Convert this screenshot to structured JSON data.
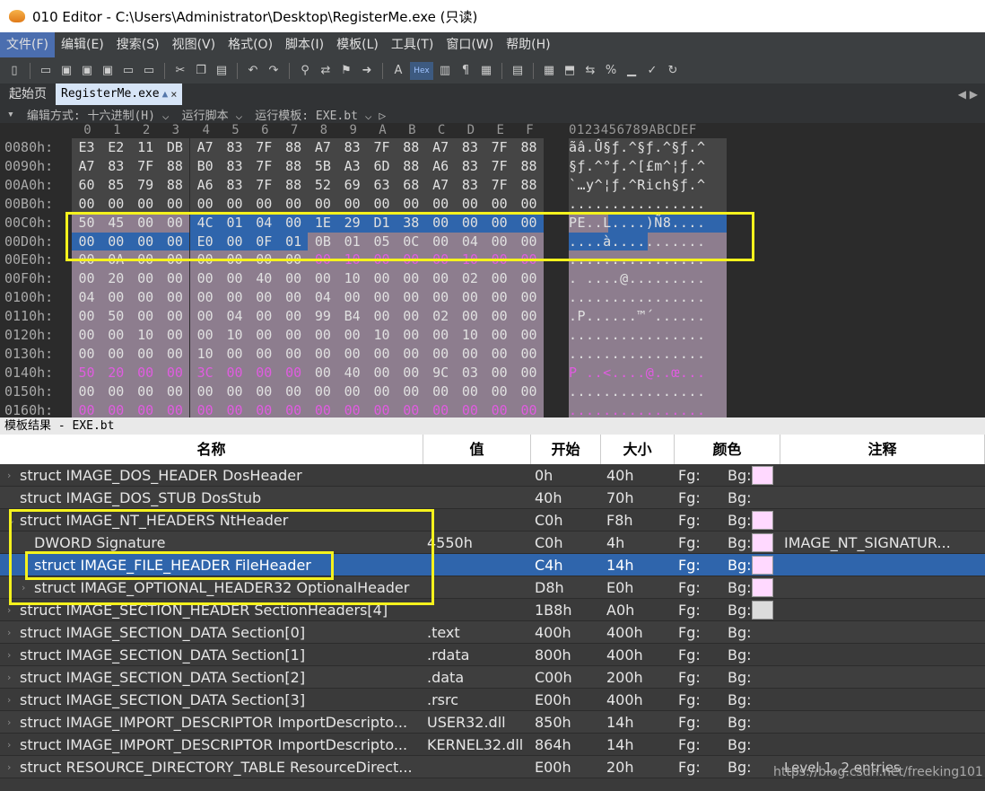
{
  "window": {
    "title": "010 Editor - C:\\Users\\Administrator\\Desktop\\RegisterMe.exe (只读)"
  },
  "menu": [
    "文件(F)",
    "编辑(E)",
    "搜索(S)",
    "视图(V)",
    "格式(O)",
    "脚本(I)",
    "模板(L)",
    "工具(T)",
    "窗口(W)",
    "帮助(H)"
  ],
  "toolbar": {
    "icons": [
      "new-file-icon",
      "open-folder-icon",
      "save-icon",
      "save-as-icon",
      "save-all-icon",
      "open-icon",
      "copy-files-icon",
      "cut-icon",
      "copy-icon",
      "paste-icon",
      "undo-icon",
      "redo-icon",
      "find-icon",
      "replace-icon",
      "find-files-icon",
      "goto-icon",
      "font-icon",
      "hex-icon",
      "columns-icon",
      "pilcrow-icon",
      "grid-icon",
      "binary-icon",
      "calculator-icon",
      "compare-icon",
      "swap-icon",
      "percent-icon",
      "histogram-icon",
      "check-icon",
      "convert-icon"
    ],
    "hex_label": "Hex"
  },
  "tabs": {
    "start": "起始页",
    "active": "RegisterMe.exe",
    "close": "×",
    "arrows": "◀ ▶"
  },
  "options": {
    "edit_mode": "编辑方式: 十六进制(H) ⌵",
    "run_script": "运行脚本 ⌵",
    "run_template": "运行模板: EXE.bt ⌵ ▷"
  },
  "hex": {
    "columns": [
      "0",
      "1",
      "2",
      "3",
      "4",
      "5",
      "6",
      "7",
      "8",
      "9",
      "A",
      "B",
      "C",
      "D",
      "E",
      "F"
    ],
    "ascii_header": "0123456789ABCDEF",
    "rows": [
      {
        "addr": "0080h:",
        "bytes": [
          "E3",
          "E2",
          "11",
          "DB",
          "A7",
          "83",
          "7F",
          "88",
          "A7",
          "83",
          "7F",
          "88",
          "A7",
          "83",
          "7F",
          "88"
        ],
        "ascii": "ãâ.Û§ƒ.^§ƒ.^§ƒ.^"
      },
      {
        "addr": "0090h:",
        "bytes": [
          "A7",
          "83",
          "7F",
          "88",
          "B0",
          "83",
          "7F",
          "88",
          "5B",
          "A3",
          "6D",
          "88",
          "A6",
          "83",
          "7F",
          "88"
        ],
        "ascii": "§ƒ.^°ƒ.^[£m^¦ƒ.^"
      },
      {
        "addr": "00A0h:",
        "bytes": [
          "60",
          "85",
          "79",
          "88",
          "A6",
          "83",
          "7F",
          "88",
          "52",
          "69",
          "63",
          "68",
          "A7",
          "83",
          "7F",
          "88"
        ],
        "ascii": "`…y^¦ƒ.^Rich§ƒ.^"
      },
      {
        "addr": "00B0h:",
        "bytes": [
          "00",
          "00",
          "00",
          "00",
          "00",
          "00",
          "00",
          "00",
          "00",
          "00",
          "00",
          "00",
          "00",
          "00",
          "00",
          "00"
        ],
        "ascii": "................"
      },
      {
        "addr": "00C0h:",
        "bytes": [
          "50",
          "45",
          "00",
          "00",
          "4C",
          "01",
          "04",
          "00",
          "1E",
          "29",
          "D1",
          "38",
          "00",
          "00",
          "00",
          "00"
        ],
        "ascii": "PE..L....)Ñ8...."
      },
      {
        "addr": "00D0h:",
        "bytes": [
          "00",
          "00",
          "00",
          "00",
          "E0",
          "00",
          "0F",
          "01",
          "0B",
          "01",
          "05",
          "0C",
          "00",
          "04",
          "00",
          "00"
        ],
        "ascii": "....à..........."
      },
      {
        "addr": "00E0h:",
        "bytes": [
          "00",
          "0A",
          "00",
          "00",
          "00",
          "00",
          "00",
          "00",
          "00",
          "10",
          "00",
          "00",
          "00",
          "10",
          "00",
          "00"
        ],
        "ascii": "................"
      },
      {
        "addr": "00F0h:",
        "bytes": [
          "00",
          "20",
          "00",
          "00",
          "00",
          "00",
          "40",
          "00",
          "00",
          "10",
          "00",
          "00",
          "00",
          "02",
          "00",
          "00"
        ],
        "ascii": ". ....@........."
      },
      {
        "addr": "0100h:",
        "bytes": [
          "04",
          "00",
          "00",
          "00",
          "00",
          "00",
          "00",
          "00",
          "04",
          "00",
          "00",
          "00",
          "00",
          "00",
          "00",
          "00"
        ],
        "ascii": "................"
      },
      {
        "addr": "0110h:",
        "bytes": [
          "00",
          "50",
          "00",
          "00",
          "00",
          "04",
          "00",
          "00",
          "99",
          "B4",
          "00",
          "00",
          "02",
          "00",
          "00",
          "00"
        ],
        "ascii": ".P......™´......"
      },
      {
        "addr": "0120h:",
        "bytes": [
          "00",
          "00",
          "10",
          "00",
          "00",
          "10",
          "00",
          "00",
          "00",
          "00",
          "10",
          "00",
          "00",
          "10",
          "00",
          "00"
        ],
        "ascii": "................"
      },
      {
        "addr": "0130h:",
        "bytes": [
          "00",
          "00",
          "00",
          "00",
          "10",
          "00",
          "00",
          "00",
          "00",
          "00",
          "00",
          "00",
          "00",
          "00",
          "00",
          "00"
        ],
        "ascii": "................"
      },
      {
        "addr": "0140h:",
        "bytes": [
          "50",
          "20",
          "00",
          "00",
          "3C",
          "00",
          "00",
          "00",
          "00",
          "40",
          "00",
          "00",
          "9C",
          "03",
          "00",
          "00"
        ],
        "ascii": "P ..<....@..œ..."
      },
      {
        "addr": "0150h:",
        "bytes": [
          "00",
          "00",
          "00",
          "00",
          "00",
          "00",
          "00",
          "00",
          "00",
          "00",
          "00",
          "00",
          "00",
          "00",
          "00",
          "00"
        ],
        "ascii": "................"
      },
      {
        "addr": "0160h:",
        "bytes": [
          "00",
          "00",
          "00",
          "00",
          "00",
          "00",
          "00",
          "00",
          "00",
          "00",
          "00",
          "00",
          "00",
          "00",
          "00",
          "00"
        ],
        "ascii": "................"
      }
    ]
  },
  "template_panel": {
    "title": "模板结果 - EXE.bt",
    "headers": {
      "name": "名称",
      "value": "值",
      "start": "开始",
      "size": "大小",
      "color": "颜色",
      "comment": "注释"
    },
    "rows": [
      {
        "name": "struct IMAGE_DOS_HEADER DosHeader",
        "value": "",
        "start": "0h",
        "size": "40h",
        "fg": "Fg:",
        "bg": "Bg:",
        "swatch": "#ffd9ff",
        "comment": ""
      },
      {
        "name": "struct IMAGE_DOS_STUB DosStub",
        "value": "",
        "start": "40h",
        "size": "70h",
        "fg": "Fg:",
        "bg": "Bg:",
        "swatch": "",
        "comment": ""
      },
      {
        "name": "struct IMAGE_NT_HEADERS NtHeader",
        "value": "",
        "start": "C0h",
        "size": "F8h",
        "fg": "Fg:",
        "bg": "Bg:",
        "swatch": "#ffd9ff",
        "comment": ""
      },
      {
        "name": "DWORD Signature",
        "value": "4550h",
        "start": "C0h",
        "size": "4h",
        "fg": "Fg:",
        "bg": "Bg:",
        "swatch": "#ffd9ff",
        "comment": "IMAGE_NT_SIGNATUR..."
      },
      {
        "name": "struct IMAGE_FILE_HEADER FileHeader",
        "value": "",
        "start": "C4h",
        "size": "14h",
        "fg": "Fg:",
        "bg": "Bg:",
        "swatch": "#ffd9ff",
        "comment": ""
      },
      {
        "name": "struct IMAGE_OPTIONAL_HEADER32 OptionalHeader",
        "value": "",
        "start": "D8h",
        "size": "E0h",
        "fg": "Fg:",
        "bg": "Bg:",
        "swatch": "#ffd9ff",
        "comment": ""
      },
      {
        "name": "struct IMAGE_SECTION_HEADER SectionHeaders[4]",
        "value": "",
        "start": "1B8h",
        "size": "A0h",
        "fg": "Fg:",
        "bg": "Bg:",
        "swatch": "#dcdcdc",
        "comment": ""
      },
      {
        "name": "struct IMAGE_SECTION_DATA Section[0]",
        "value": ".text",
        "start": "400h",
        "size": "400h",
        "fg": "Fg:",
        "bg": "Bg:",
        "swatch": "",
        "comment": ""
      },
      {
        "name": "struct IMAGE_SECTION_DATA Section[1]",
        "value": ".rdata",
        "start": "800h",
        "size": "400h",
        "fg": "Fg:",
        "bg": "Bg:",
        "swatch": "",
        "comment": ""
      },
      {
        "name": "struct IMAGE_SECTION_DATA Section[2]",
        "value": ".data",
        "start": "C00h",
        "size": "200h",
        "fg": "Fg:",
        "bg": "Bg:",
        "swatch": "",
        "comment": ""
      },
      {
        "name": "struct IMAGE_SECTION_DATA Section[3]",
        "value": ".rsrc",
        "start": "E00h",
        "size": "400h",
        "fg": "Fg:",
        "bg": "Bg:",
        "swatch": "",
        "comment": ""
      },
      {
        "name": "struct IMAGE_IMPORT_DESCRIPTOR ImportDescripto...",
        "value": "USER32.dll",
        "start": "850h",
        "size": "14h",
        "fg": "Fg:",
        "bg": "Bg:",
        "swatch": "",
        "comment": ""
      },
      {
        "name": "struct IMAGE_IMPORT_DESCRIPTOR ImportDescripto...",
        "value": "KERNEL32.dll",
        "start": "864h",
        "size": "14h",
        "fg": "Fg:",
        "bg": "Bg:",
        "swatch": "",
        "comment": ""
      },
      {
        "name": "struct RESOURCE_DIRECTORY_TABLE ResourceDirect...",
        "value": "",
        "start": "E00h",
        "size": "20h",
        "fg": "Fg:",
        "bg": "Bg:",
        "swatch": "",
        "comment": ""
      }
    ],
    "status": "Level 1, 2 entries",
    "watermark": "https://blog.csdn.net/freeking101"
  },
  "colors": {
    "selection": "#2f65ac",
    "highlight_box": "#f5f21d",
    "template_pink": "#8d7d8e",
    "magenta": "#e05ce0"
  }
}
